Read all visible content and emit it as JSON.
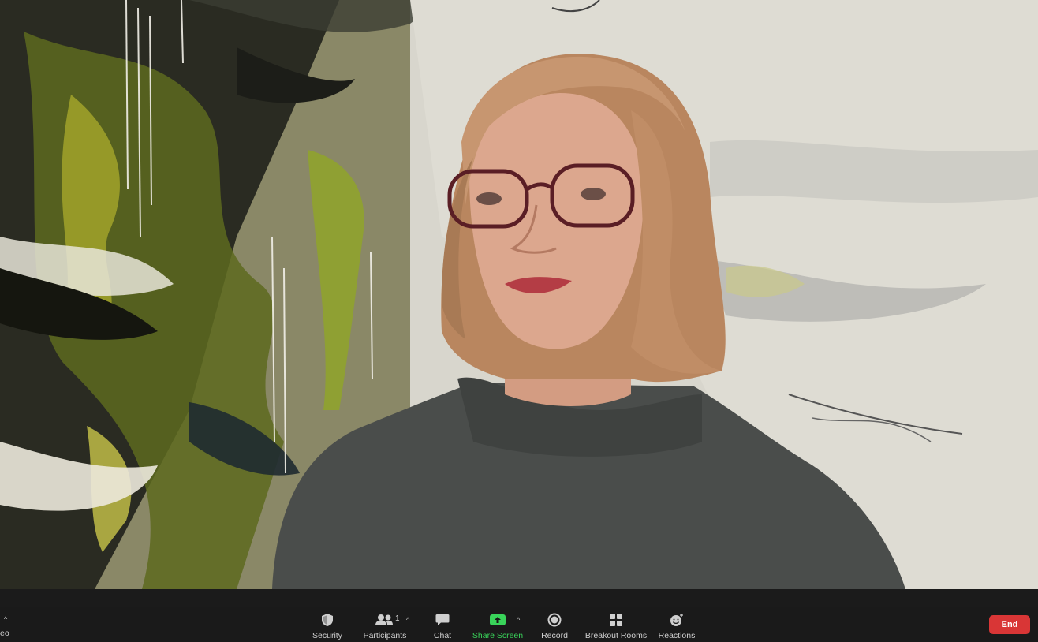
{
  "meeting": {
    "video_partial_label": "eo"
  },
  "toolbar": {
    "security_label": "Security",
    "participants_label": "Participants",
    "participants_count": "1",
    "chat_label": "Chat",
    "share_screen_label": "Share Screen",
    "record_label": "Record",
    "breakout_rooms_label": "Breakout Rooms",
    "reactions_label": "Reactions",
    "end_label": "End"
  },
  "icons": {
    "security": "shield-icon",
    "participants": "participants-icon",
    "chat": "chat-icon",
    "share_screen": "share-screen-icon",
    "record": "record-icon",
    "breakout_rooms": "grid-icon",
    "reactions": "smiley-icon"
  },
  "colors": {
    "toolbar_bg": "#1a1a1a",
    "share_green": "#39d45a",
    "end_red": "#d93636"
  }
}
